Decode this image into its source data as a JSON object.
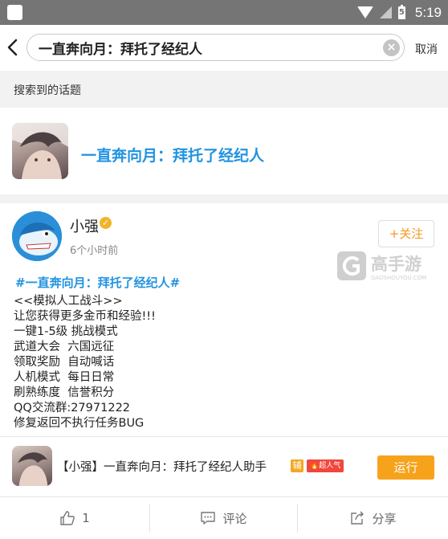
{
  "status_bar": {
    "time": "5:19",
    "battery_level": "5"
  },
  "header": {
    "search_value": "一直奔向月：拜托了经纪人",
    "clear_symbol": "×",
    "cancel_label": "取消"
  },
  "section": {
    "label": "搜索到的话题"
  },
  "topic": {
    "title": "一直奔向月：拜托了经纪人"
  },
  "post": {
    "username": "小强",
    "verified_symbol": "✓",
    "time": "6个小时前",
    "follow_label": "+关注",
    "tag": "#一直奔向月：拜托了经纪人#",
    "lines": [
      "<<模拟人工战斗>>",
      "让您获得更多金币和经验!!!",
      "一键1-5级 挑战模式",
      "武道大会  六国远征",
      "领取奖励  自动喊话",
      "人机模式  每日日常",
      "刷熟练度  信誉积分",
      "QQ交流群:27971222",
      "修复返回不执行任务BUG"
    ]
  },
  "watermark": {
    "brand": "高手游",
    "domain": "GAOSHOUYOU.COM"
  },
  "game": {
    "title": "【小强】一直奔向月：拜托了经纪人助手",
    "badge_assist": "辅",
    "badge_hot": "超人气",
    "run_label": "运行"
  },
  "actions": {
    "like_count": "1",
    "comment_label": "评论",
    "share_label": "分享"
  },
  "colors": {
    "accent_blue": "#2193e0",
    "accent_orange": "#f7a21b",
    "status_bar": "#757575"
  }
}
